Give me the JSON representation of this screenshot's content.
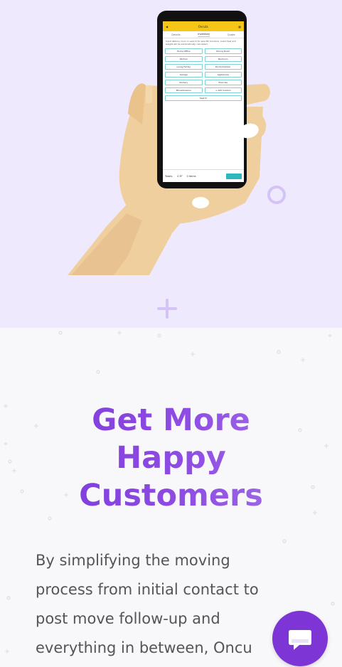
{
  "colors": {
    "hero_bg": "#efe9fd",
    "section_bg": "#f8f8fa",
    "accent_purple": "#7d35d6",
    "headline_gradient_start": "#7a35d7",
    "headline_gradient_end": "#a77ce8",
    "phone_header": "#f5c518",
    "phone_accent_teal": "#2fb6bd",
    "skin": "#f0cf9f",
    "body_text": "#555555"
  },
  "phone_app": {
    "title": "Oncula",
    "tabs": [
      "Details",
      "Inventory",
      "Quote"
    ],
    "active_tab": "Inventory",
    "description": "Input data by room or search for specific furniture. Cubic feet and weight will be automatically calculated.",
    "rooms": [
      "Home Office",
      "Dining Room",
      "Kitchen",
      "Bedroom",
      "Living Family",
      "Porch/Outdoor",
      "Garage",
      "Appliances",
      "Nursery",
      "Exercise",
      "Miscellaneous",
      "+ Add Custom"
    ],
    "search_label": "Search",
    "footer_totals_label": "Totals:",
    "footer_cubic": "0 ft³",
    "footer_items": "0 items"
  },
  "hero": {
    "icons": [
      "phone-in-hand-illustration",
      "circle-decoration-icon",
      "plus-decoration-icon"
    ]
  },
  "main": {
    "headline_line1": "Get More",
    "headline_line2": "Happy",
    "headline_line3": "Customers",
    "body": "By simplifying the moving\nprocess from initial contact to\npost move follow-up and\neverything in between, Oncu"
  },
  "chat_widget": {
    "icon": "chat-bubble-icon"
  }
}
